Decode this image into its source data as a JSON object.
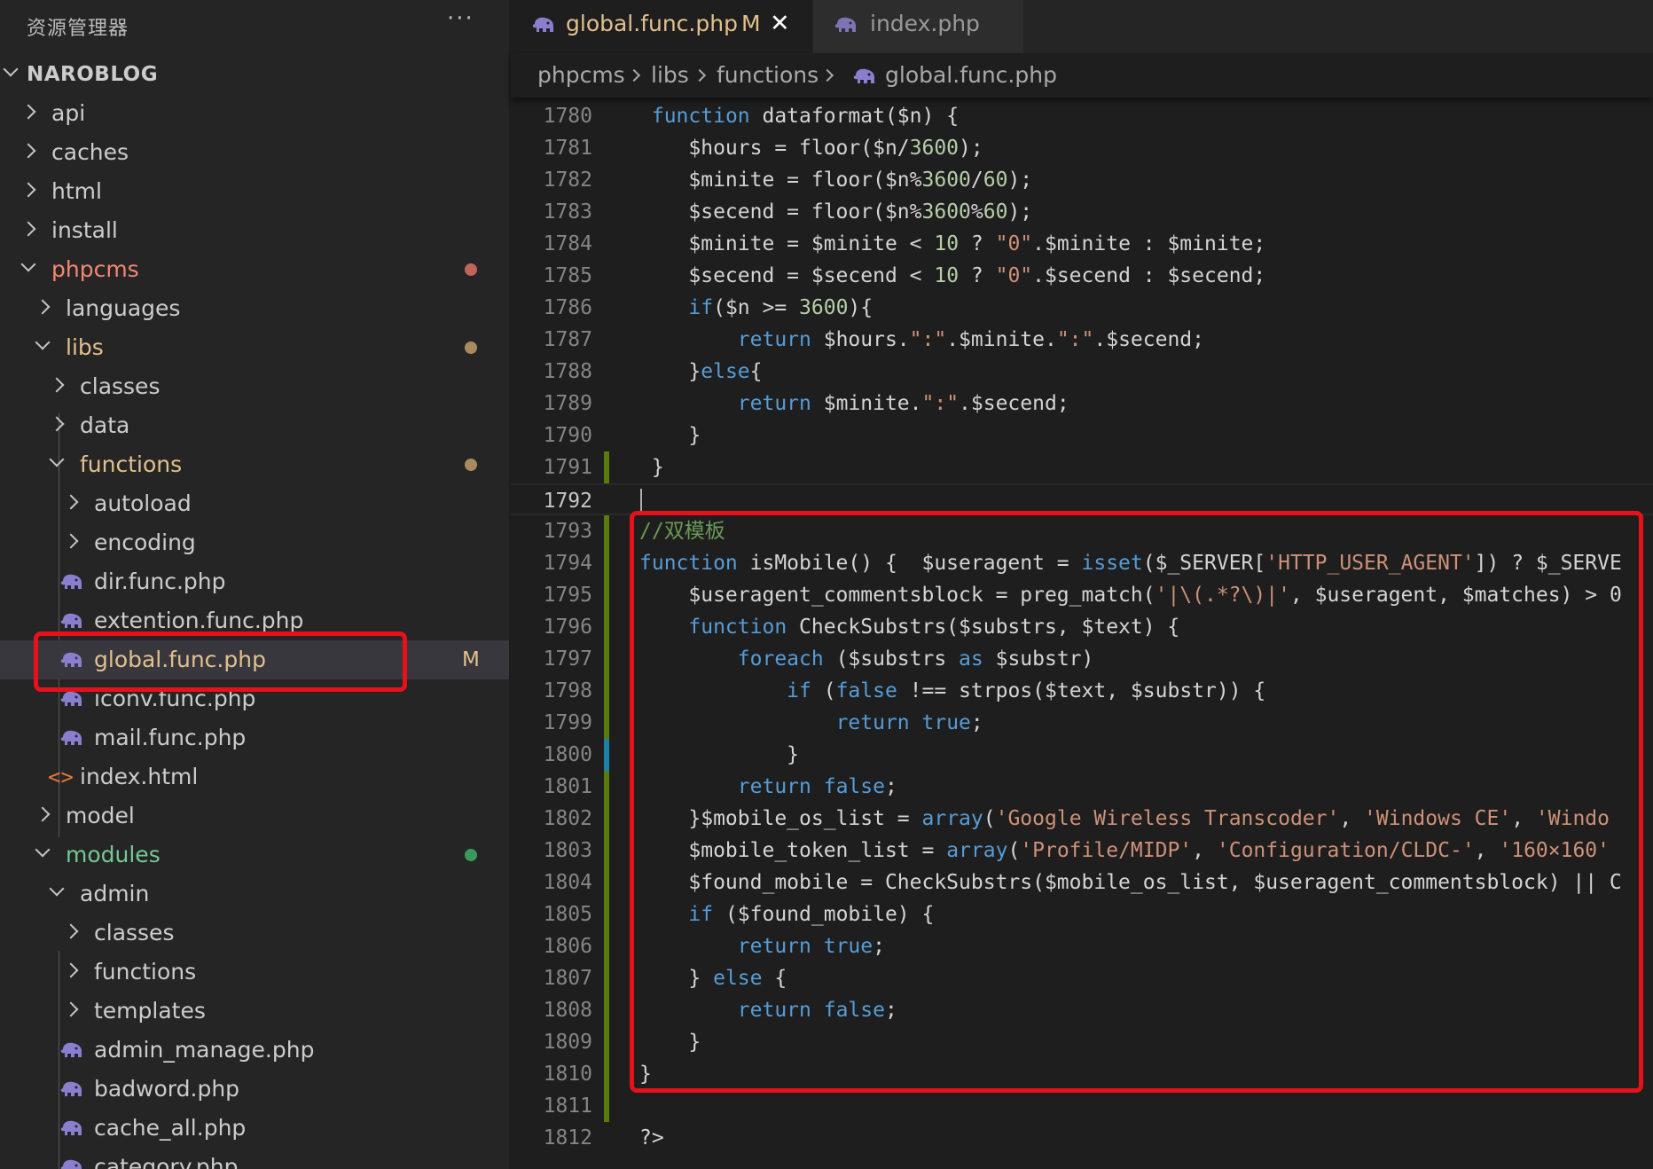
{
  "sidebar": {
    "title": "资源管理器",
    "more": "···",
    "root": "NAROBLOG",
    "items": [
      {
        "label": "api"
      },
      {
        "label": "caches"
      },
      {
        "label": "html"
      },
      {
        "label": "install"
      },
      {
        "label": "phpcms"
      },
      {
        "label": "languages"
      },
      {
        "label": "libs"
      },
      {
        "label": "classes"
      },
      {
        "label": "data"
      },
      {
        "label": "functions"
      },
      {
        "label": "autoload"
      },
      {
        "label": "encoding"
      },
      {
        "label": "dir.func.php"
      },
      {
        "label": "extention.func.php"
      },
      {
        "label": "global.func.php",
        "badge": "M"
      },
      {
        "label": "iconv.func.php"
      },
      {
        "label": "mail.func.php"
      },
      {
        "label": "index.html"
      },
      {
        "label": "model"
      },
      {
        "label": "modules"
      },
      {
        "label": "admin"
      },
      {
        "label": "classes"
      },
      {
        "label": "functions"
      },
      {
        "label": "templates"
      },
      {
        "label": "admin_manage.php"
      },
      {
        "label": "badword.php"
      },
      {
        "label": "cache_all.php"
      },
      {
        "label": "category.php"
      }
    ]
  },
  "tabs": [
    {
      "name": "global.func.php",
      "modified": "M",
      "close": "✕"
    },
    {
      "name": "index.php"
    }
  ],
  "breadcrumb": [
    "phpcms",
    "libs",
    "functions",
    "global.func.php"
  ],
  "colors": {
    "highlight": "#e8111b",
    "modified_yellow": "#e2c08d",
    "modified_red": "#f48771",
    "added_green": "#73c991",
    "php_icon": "#8a7fcf"
  },
  "editor": {
    "lines": [
      {
        "n": "1780",
        "t": " function dataformat($n) {"
      },
      {
        "n": "1781",
        "t": "    $hours = floor($n/3600);"
      },
      {
        "n": "1782",
        "t": "    $minite = floor($n%3600/60);"
      },
      {
        "n": "1783",
        "t": "    $secend = floor($n%3600%60);"
      },
      {
        "n": "1784",
        "t": "    $minite = $minite < 10 ? \"0\".$minite : $minite;"
      },
      {
        "n": "1785",
        "t": "    $secend = $secend < 10 ? \"0\".$secend : $secend;"
      },
      {
        "n": "1786",
        "t": "    if($n >= 3600){"
      },
      {
        "n": "1787",
        "t": "        return $hours.\":\".$minite.\":\".$secend;"
      },
      {
        "n": "1788",
        "t": "    }else{"
      },
      {
        "n": "1789",
        "t": "        return $minite.\":\".$secend;"
      },
      {
        "n": "1790",
        "t": "    }"
      },
      {
        "n": "1791",
        "t": " }"
      },
      {
        "n": "1792",
        "t": ""
      },
      {
        "n": "1793",
        "t": "//双模板"
      },
      {
        "n": "1794",
        "t": "function isMobile() {  $useragent = isset($_SERVER['HTTP_USER_AGENT']) ? $_SERVE"
      },
      {
        "n": "1795",
        "t": "    $useragent_commentsblock = preg_match('|\\(.*?\\)|', $useragent, $matches) > 0"
      },
      {
        "n": "1796",
        "t": "    function CheckSubstrs($substrs, $text) {"
      },
      {
        "n": "1797",
        "t": "        foreach ($substrs as $substr)"
      },
      {
        "n": "1798",
        "t": "            if (false !== strpos($text, $substr)) {"
      },
      {
        "n": "1799",
        "t": "                return true;"
      },
      {
        "n": "1800",
        "t": "            }"
      },
      {
        "n": "1801",
        "t": "        return false;"
      },
      {
        "n": "1802",
        "t": "    }$mobile_os_list = array('Google Wireless Transcoder', 'Windows CE', 'Windo"
      },
      {
        "n": "1803",
        "t": "    $mobile_token_list = array('Profile/MIDP', 'Configuration/CLDC-', '160×160'"
      },
      {
        "n": "1804",
        "t": "    $found_mobile = CheckSubstrs($mobile_os_list, $useragent_commentsblock) || C"
      },
      {
        "n": "1805",
        "t": "    if ($found_mobile) {"
      },
      {
        "n": "1806",
        "t": "        return true;"
      },
      {
        "n": "1807",
        "t": "    } else {"
      },
      {
        "n": "1808",
        "t": "        return false;"
      },
      {
        "n": "1809",
        "t": "    }"
      },
      {
        "n": "1810",
        "t": "}"
      },
      {
        "n": "1811",
        "t": ""
      },
      {
        "n": "1812",
        "t": "?>"
      }
    ]
  }
}
